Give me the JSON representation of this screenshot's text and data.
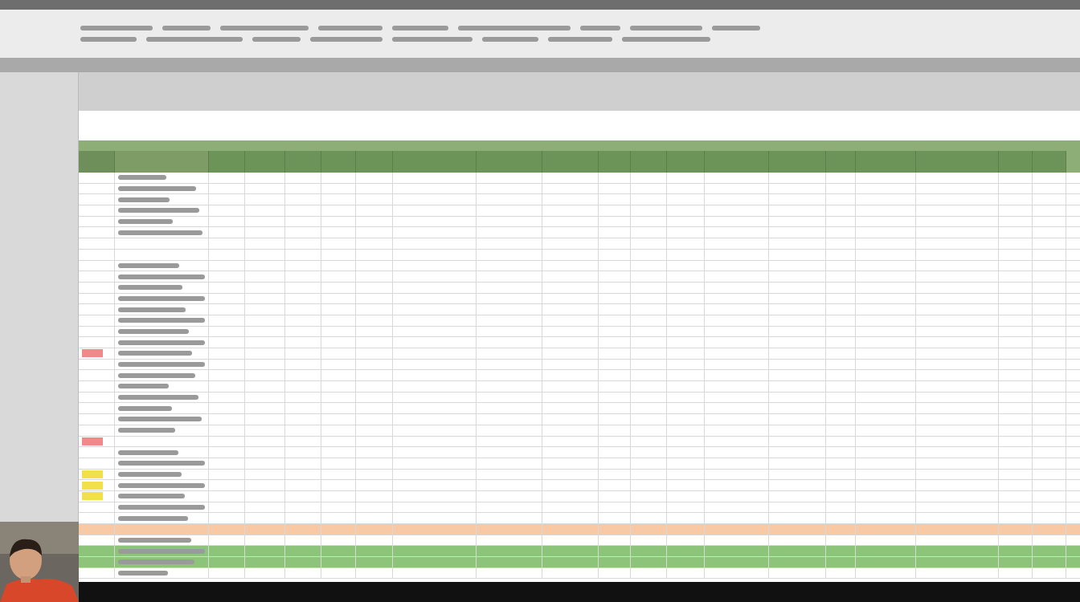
{
  "columns": [
    {
      "kind": "num"
    },
    {
      "kind": "label"
    },
    {
      "kind": "data"
    },
    {
      "kind": "data"
    },
    {
      "kind": "data"
    },
    {
      "kind": "data"
    },
    {
      "kind": "data"
    },
    {
      "kind": "data"
    },
    {
      "kind": "data"
    },
    {
      "kind": "data"
    },
    {
      "kind": "data"
    },
    {
      "kind": "data"
    },
    {
      "kind": "data"
    },
    {
      "kind": "data"
    },
    {
      "kind": "data"
    },
    {
      "kind": "data"
    },
    {
      "kind": "data"
    },
    {
      "kind": "data"
    },
    {
      "kind": "data"
    },
    {
      "kind": "data"
    }
  ],
  "rows": [
    {
      "kind": "text"
    },
    {
      "kind": "text"
    },
    {
      "kind": "text"
    },
    {
      "kind": "text"
    },
    {
      "kind": "text"
    },
    {
      "kind": "text"
    },
    {
      "kind": "empty"
    },
    {
      "kind": "empty"
    },
    {
      "kind": "text"
    },
    {
      "kind": "text"
    },
    {
      "kind": "text"
    },
    {
      "kind": "text"
    },
    {
      "kind": "text"
    },
    {
      "kind": "text"
    },
    {
      "kind": "text"
    },
    {
      "kind": "text"
    },
    {
      "kind": "text",
      "color": "#f08a8a"
    },
    {
      "kind": "text"
    },
    {
      "kind": "text"
    },
    {
      "kind": "text"
    },
    {
      "kind": "text"
    },
    {
      "kind": "text"
    },
    {
      "kind": "text"
    },
    {
      "kind": "text"
    },
    {
      "kind": "empty",
      "color": "#f08a8a"
    },
    {
      "kind": "text"
    },
    {
      "kind": "text"
    },
    {
      "kind": "text",
      "color": "#f2e04a"
    },
    {
      "kind": "text",
      "color": "#f2e04a"
    },
    {
      "kind": "text",
      "color": "#f2e04a"
    },
    {
      "kind": "text"
    },
    {
      "kind": "text"
    },
    {
      "kind": "orange"
    },
    {
      "kind": "text"
    },
    {
      "kind": "green"
    },
    {
      "kind": "green"
    },
    {
      "kind": "text"
    }
  ]
}
